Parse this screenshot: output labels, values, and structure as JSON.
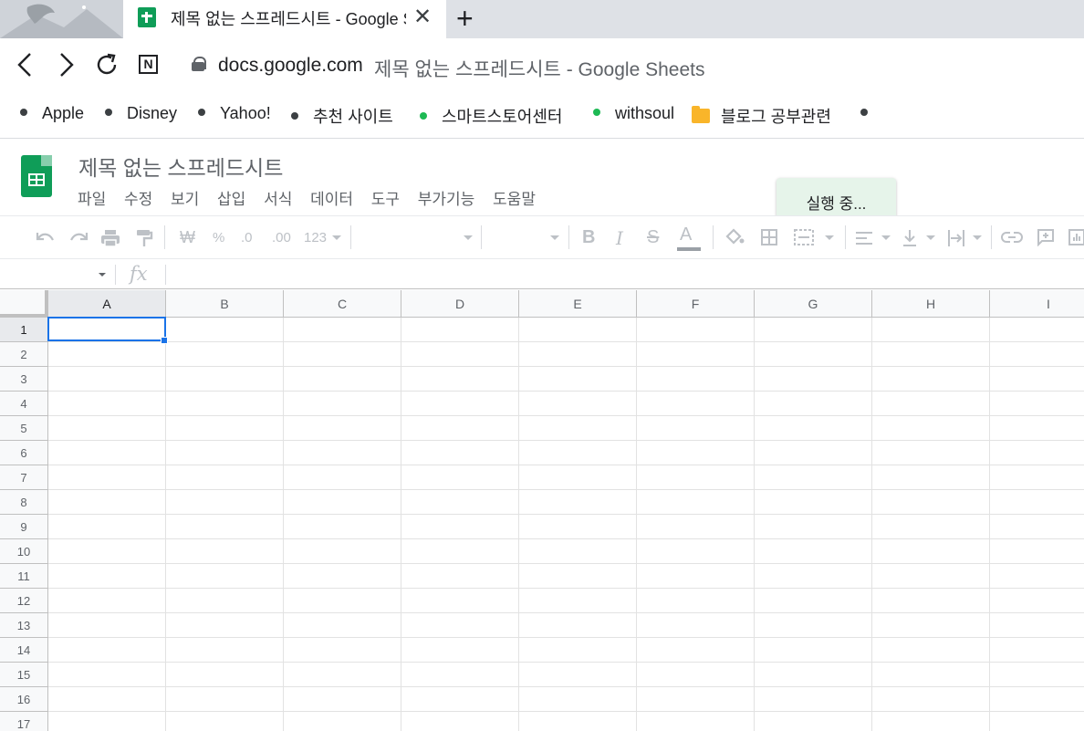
{
  "browser": {
    "active_tab_title": "제목 없는 스프레드시트 - Google Sheets",
    "close_glyph": "✕",
    "new_tab_glyph": "+",
    "url_domain": "docs.google.com",
    "url_rest": "제목 없는 스프레드시트 - Google Sheets",
    "n_logo": "N"
  },
  "bookmarks": [
    {
      "label": "Apple",
      "icon": "dot"
    },
    {
      "label": "Disney",
      "icon": "dot"
    },
    {
      "label": "Yahoo!",
      "icon": "dot"
    },
    {
      "label": "추천 사이트",
      "icon": "dot"
    },
    {
      "label": "스마트스토어센터",
      "icon": "green-dot"
    },
    {
      "label": "withsoul",
      "icon": "green-dot"
    },
    {
      "label": "블로그 공부관련",
      "icon": "folder"
    }
  ],
  "sheets": {
    "title": "제목 없는 스프레드시트",
    "menu": [
      "파일",
      "수정",
      "보기",
      "삽입",
      "서식",
      "데이터",
      "도구",
      "부가기능",
      "도움말"
    ],
    "status_toast": "실행 중...",
    "toolbar": {
      "currency": "₩",
      "percent": "%",
      "decimal_decrease": ".0",
      "decimal_increase": ".00",
      "more_formats": "123",
      "bold": "B",
      "italic": "I",
      "strike": "S",
      "text_color": "A"
    },
    "fx_label": "fx",
    "columns": [
      "A",
      "B",
      "C",
      "D",
      "E",
      "F",
      "G",
      "H",
      "I"
    ],
    "rows": [
      "1",
      "2",
      "3",
      "4",
      "5",
      "6",
      "7",
      "8",
      "9",
      "10",
      "11",
      "12",
      "13",
      "14",
      "15",
      "16",
      "17"
    ],
    "selected_cell": "A1"
  },
  "colors": {
    "accent": "#1a73e8",
    "sheets_green": "#0f9d58",
    "toast_bg": "#e6f4ea"
  }
}
